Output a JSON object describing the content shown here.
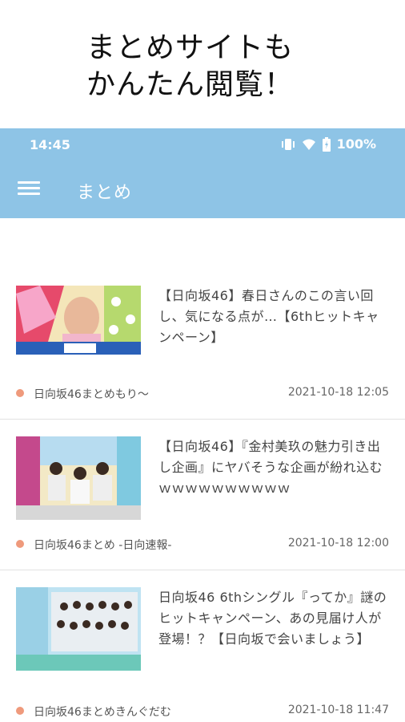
{
  "promo": {
    "line1": "まとめサイトも",
    "line2": "かんたん閲覧！"
  },
  "status_bar": {
    "time": "14:45",
    "battery": "100%",
    "icons": [
      "vibrate-icon",
      "wifi-icon",
      "battery-icon"
    ]
  },
  "app_bar": {
    "title": "まとめ",
    "menu_icon": "hamburger-menu-icon"
  },
  "colors": {
    "app_bar": "#8ec4e6",
    "source_dot": "#ef9a7c"
  },
  "articles": [
    {
      "title": "【日向坂46】春日さんのこの言い回し、気になる点が…【6thヒットキャンペーン】",
      "source": "日向坂46まとめもり〜",
      "date": "2021-10-18 12:05"
    },
    {
      "title": "【日向坂46】『金村美玖の魅力引き出し企画』にヤバそうな企画が紛れ込むｗｗｗｗｗｗｗｗｗｗ",
      "source": "日向坂46まとめ -日向速報-",
      "date": "2021-10-18 12:00"
    },
    {
      "title": "日向坂46 6thシングル『ってか』謎のヒットキャンペーン、あの見届け人が登場！？【日向坂で会いましょう】",
      "source": "日向坂46まとめきんぐだむ",
      "date": "2021-10-18 11:47"
    }
  ]
}
